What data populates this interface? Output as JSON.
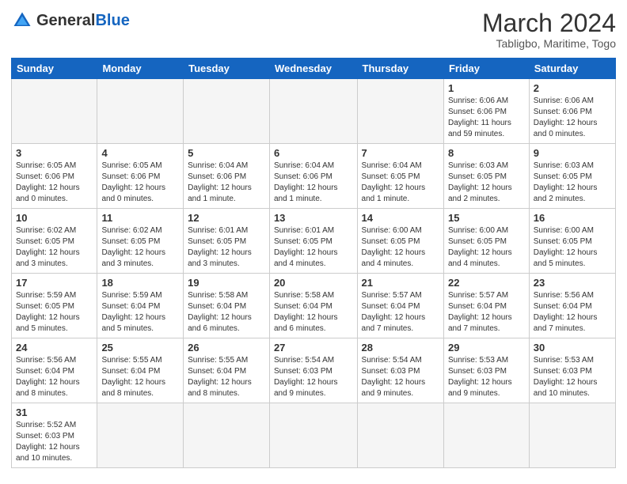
{
  "logo": {
    "general": "General",
    "blue": "Blue"
  },
  "header": {
    "month": "March 2024",
    "location": "Tabligbo, Maritime, Togo"
  },
  "weekdays": [
    "Sunday",
    "Monday",
    "Tuesday",
    "Wednesday",
    "Thursday",
    "Friday",
    "Saturday"
  ],
  "weeks": [
    [
      {
        "day": "",
        "info": ""
      },
      {
        "day": "",
        "info": ""
      },
      {
        "day": "",
        "info": ""
      },
      {
        "day": "",
        "info": ""
      },
      {
        "day": "",
        "info": ""
      },
      {
        "day": "1",
        "info": "Sunrise: 6:06 AM\nSunset: 6:06 PM\nDaylight: 11 hours and 59 minutes."
      },
      {
        "day": "2",
        "info": "Sunrise: 6:06 AM\nSunset: 6:06 PM\nDaylight: 12 hours and 0 minutes."
      }
    ],
    [
      {
        "day": "3",
        "info": "Sunrise: 6:05 AM\nSunset: 6:06 PM\nDaylight: 12 hours and 0 minutes."
      },
      {
        "day": "4",
        "info": "Sunrise: 6:05 AM\nSunset: 6:06 PM\nDaylight: 12 hours and 0 minutes."
      },
      {
        "day": "5",
        "info": "Sunrise: 6:04 AM\nSunset: 6:06 PM\nDaylight: 12 hours and 1 minute."
      },
      {
        "day": "6",
        "info": "Sunrise: 6:04 AM\nSunset: 6:06 PM\nDaylight: 12 hours and 1 minute."
      },
      {
        "day": "7",
        "info": "Sunrise: 6:04 AM\nSunset: 6:05 PM\nDaylight: 12 hours and 1 minute."
      },
      {
        "day": "8",
        "info": "Sunrise: 6:03 AM\nSunset: 6:05 PM\nDaylight: 12 hours and 2 minutes."
      },
      {
        "day": "9",
        "info": "Sunrise: 6:03 AM\nSunset: 6:05 PM\nDaylight: 12 hours and 2 minutes."
      }
    ],
    [
      {
        "day": "10",
        "info": "Sunrise: 6:02 AM\nSunset: 6:05 PM\nDaylight: 12 hours and 3 minutes."
      },
      {
        "day": "11",
        "info": "Sunrise: 6:02 AM\nSunset: 6:05 PM\nDaylight: 12 hours and 3 minutes."
      },
      {
        "day": "12",
        "info": "Sunrise: 6:01 AM\nSunset: 6:05 PM\nDaylight: 12 hours and 3 minutes."
      },
      {
        "day": "13",
        "info": "Sunrise: 6:01 AM\nSunset: 6:05 PM\nDaylight: 12 hours and 4 minutes."
      },
      {
        "day": "14",
        "info": "Sunrise: 6:00 AM\nSunset: 6:05 PM\nDaylight: 12 hours and 4 minutes."
      },
      {
        "day": "15",
        "info": "Sunrise: 6:00 AM\nSunset: 6:05 PM\nDaylight: 12 hours and 4 minutes."
      },
      {
        "day": "16",
        "info": "Sunrise: 6:00 AM\nSunset: 6:05 PM\nDaylight: 12 hours and 5 minutes."
      }
    ],
    [
      {
        "day": "17",
        "info": "Sunrise: 5:59 AM\nSunset: 6:05 PM\nDaylight: 12 hours and 5 minutes."
      },
      {
        "day": "18",
        "info": "Sunrise: 5:59 AM\nSunset: 6:04 PM\nDaylight: 12 hours and 5 minutes."
      },
      {
        "day": "19",
        "info": "Sunrise: 5:58 AM\nSunset: 6:04 PM\nDaylight: 12 hours and 6 minutes."
      },
      {
        "day": "20",
        "info": "Sunrise: 5:58 AM\nSunset: 6:04 PM\nDaylight: 12 hours and 6 minutes."
      },
      {
        "day": "21",
        "info": "Sunrise: 5:57 AM\nSunset: 6:04 PM\nDaylight: 12 hours and 7 minutes."
      },
      {
        "day": "22",
        "info": "Sunrise: 5:57 AM\nSunset: 6:04 PM\nDaylight: 12 hours and 7 minutes."
      },
      {
        "day": "23",
        "info": "Sunrise: 5:56 AM\nSunset: 6:04 PM\nDaylight: 12 hours and 7 minutes."
      }
    ],
    [
      {
        "day": "24",
        "info": "Sunrise: 5:56 AM\nSunset: 6:04 PM\nDaylight: 12 hours and 8 minutes."
      },
      {
        "day": "25",
        "info": "Sunrise: 5:55 AM\nSunset: 6:04 PM\nDaylight: 12 hours and 8 minutes."
      },
      {
        "day": "26",
        "info": "Sunrise: 5:55 AM\nSunset: 6:04 PM\nDaylight: 12 hours and 8 minutes."
      },
      {
        "day": "27",
        "info": "Sunrise: 5:54 AM\nSunset: 6:03 PM\nDaylight: 12 hours and 9 minutes."
      },
      {
        "day": "28",
        "info": "Sunrise: 5:54 AM\nSunset: 6:03 PM\nDaylight: 12 hours and 9 minutes."
      },
      {
        "day": "29",
        "info": "Sunrise: 5:53 AM\nSunset: 6:03 PM\nDaylight: 12 hours and 9 minutes."
      },
      {
        "day": "30",
        "info": "Sunrise: 5:53 AM\nSunset: 6:03 PM\nDaylight: 12 hours and 10 minutes."
      }
    ],
    [
      {
        "day": "31",
        "info": "Sunrise: 5:52 AM\nSunset: 6:03 PM\nDaylight: 12 hours and 10 minutes."
      },
      {
        "day": "",
        "info": ""
      },
      {
        "day": "",
        "info": ""
      },
      {
        "day": "",
        "info": ""
      },
      {
        "day": "",
        "info": ""
      },
      {
        "day": "",
        "info": ""
      },
      {
        "day": "",
        "info": ""
      }
    ]
  ]
}
